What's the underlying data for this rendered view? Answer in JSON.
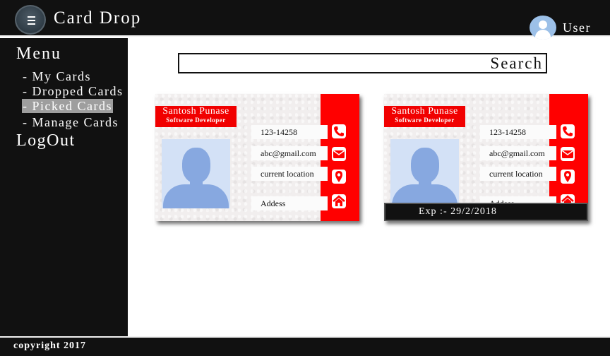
{
  "header": {
    "app_title": "Card Drop",
    "user_label": "User"
  },
  "sidebar": {
    "menu_title": "Menu",
    "items": [
      {
        "label": "- My Cards"
      },
      {
        "label": "- Dropped Cards"
      },
      {
        "label": "- Picked Cards",
        "active": true
      },
      {
        "label": "- Manage Cards"
      }
    ],
    "logout_label": "LogOut"
  },
  "search": {
    "button_label": "Search",
    "value": ""
  },
  "cards": [
    {
      "name": "Santosh Punase",
      "role": "Software Developer",
      "phone": "123-14258",
      "email": "abc@gmail.com",
      "location": "current location",
      "address": "Addess"
    },
    {
      "name": "Santosh Punase",
      "role": "Software Developer",
      "phone": "123-14258",
      "email": "abc@gmail.com",
      "location": "current location",
      "address": "Addess",
      "expiry": "Exp :- 29/2/2018"
    }
  ],
  "footer": {
    "copyright": "copyright 2017"
  },
  "colors": {
    "accent_red": "#ff0000",
    "dark": "#111111",
    "active_item": "#9e9e9e"
  },
  "icons": [
    "menu-icon",
    "user-icon",
    "phone-icon",
    "mail-icon",
    "location-pin-icon",
    "home-icon"
  ]
}
